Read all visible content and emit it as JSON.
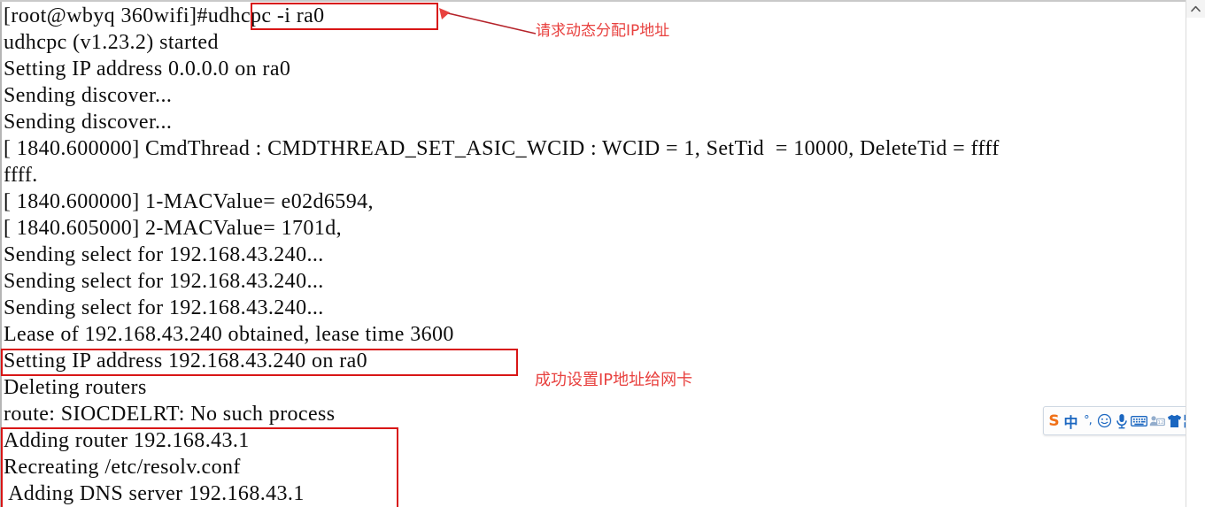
{
  "window": {
    "scrollbar": {
      "up_arrow_icon": "chevron-up-icon"
    }
  },
  "terminal": {
    "lines": [
      "[root@wbyq 360wifi]#udhcpc -i ra0",
      "udhcpc (v1.23.2) started",
      "Setting IP address 0.0.0.0 on ra0",
      "Sending discover...",
      "Sending discover...",
      "[ 1840.600000] CmdThread : CMDTHREAD_SET_ASIC_WCID : WCID = 1, SetTid  = 10000, DeleteTid = ffff",
      "ffff.",
      "[ 1840.600000] 1-MACValue= e02d6594,",
      "[ 1840.605000] 2-MACValue= 1701d,",
      "Sending select for 192.168.43.240...",
      "Sending select for 192.168.43.240...",
      "Sending select for 192.168.43.240...",
      "Lease of 192.168.43.240 obtained, lease time 3600",
      "Setting IP address 192.168.43.240 on ra0",
      "Deleting routers",
      "route: SIOCDELRT: No such process",
      "Adding router 192.168.43.1",
      "Recreating /etc/resolv.conf",
      " Adding DNS server 192.168.43.1"
    ]
  },
  "annotations": {
    "accent_color": "#e8413f",
    "box_color": "#d81616",
    "items": [
      {
        "id": "request-dhcp",
        "text": "请求动态分配IP地址"
      },
      {
        "id": "ip-set-success",
        "text": "成功设置IP地址给网卡"
      }
    ]
  },
  "ime_toolbar": {
    "brand": "S",
    "items": [
      {
        "name": "sogou-logo-icon",
        "glyph": "S",
        "type": "logo"
      },
      {
        "name": "chinese-english-toggle",
        "glyph": "中",
        "type": "cn"
      },
      {
        "name": "punctuation-toggle",
        "glyph": "°,",
        "type": "punct"
      },
      {
        "name": "emoji-icon",
        "glyph": "☺",
        "type": "icon"
      },
      {
        "name": "voice-input-icon",
        "glyph": "",
        "type": "svg-mic"
      },
      {
        "name": "soft-keyboard-icon",
        "glyph": "",
        "type": "svg-keyboard"
      },
      {
        "name": "user-card-icon",
        "glyph": "",
        "type": "svg-card"
      },
      {
        "name": "skin-icon",
        "glyph": "",
        "type": "svg-shirt"
      },
      {
        "name": "toolbox-icon",
        "glyph": "",
        "type": "svg-grid"
      }
    ]
  }
}
